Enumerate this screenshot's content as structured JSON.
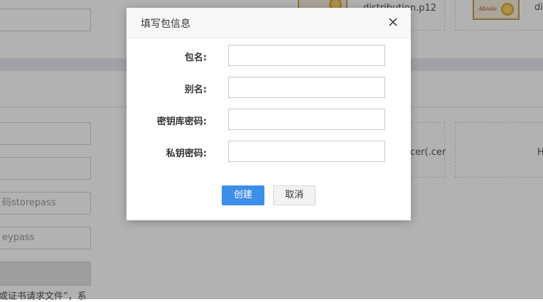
{
  "background": {
    "storepass_placeholder": "码storepass",
    "keypass_placeholder": "eypass",
    "file_p12": "distribution.p12",
    "file_cer": "cer(.cer",
    "file_right_top": "di",
    "file_right_mid": "H",
    "cert_signature": "Abiolo",
    "bottom_note": "或证书请求文件”，系"
  },
  "dialog": {
    "title": "填写包信息",
    "fields": [
      {
        "label": "包名:",
        "value": ""
      },
      {
        "label": "别名:",
        "value": ""
      },
      {
        "label": "密钥库密码:",
        "value": ""
      },
      {
        "label": "私钥密码:",
        "value": ""
      }
    ],
    "create_label": "创建",
    "cancel_label": "取消"
  },
  "colors": {
    "primary": "#3d8ee8",
    "overlay": "rgba(0,0,0,0.30)"
  }
}
